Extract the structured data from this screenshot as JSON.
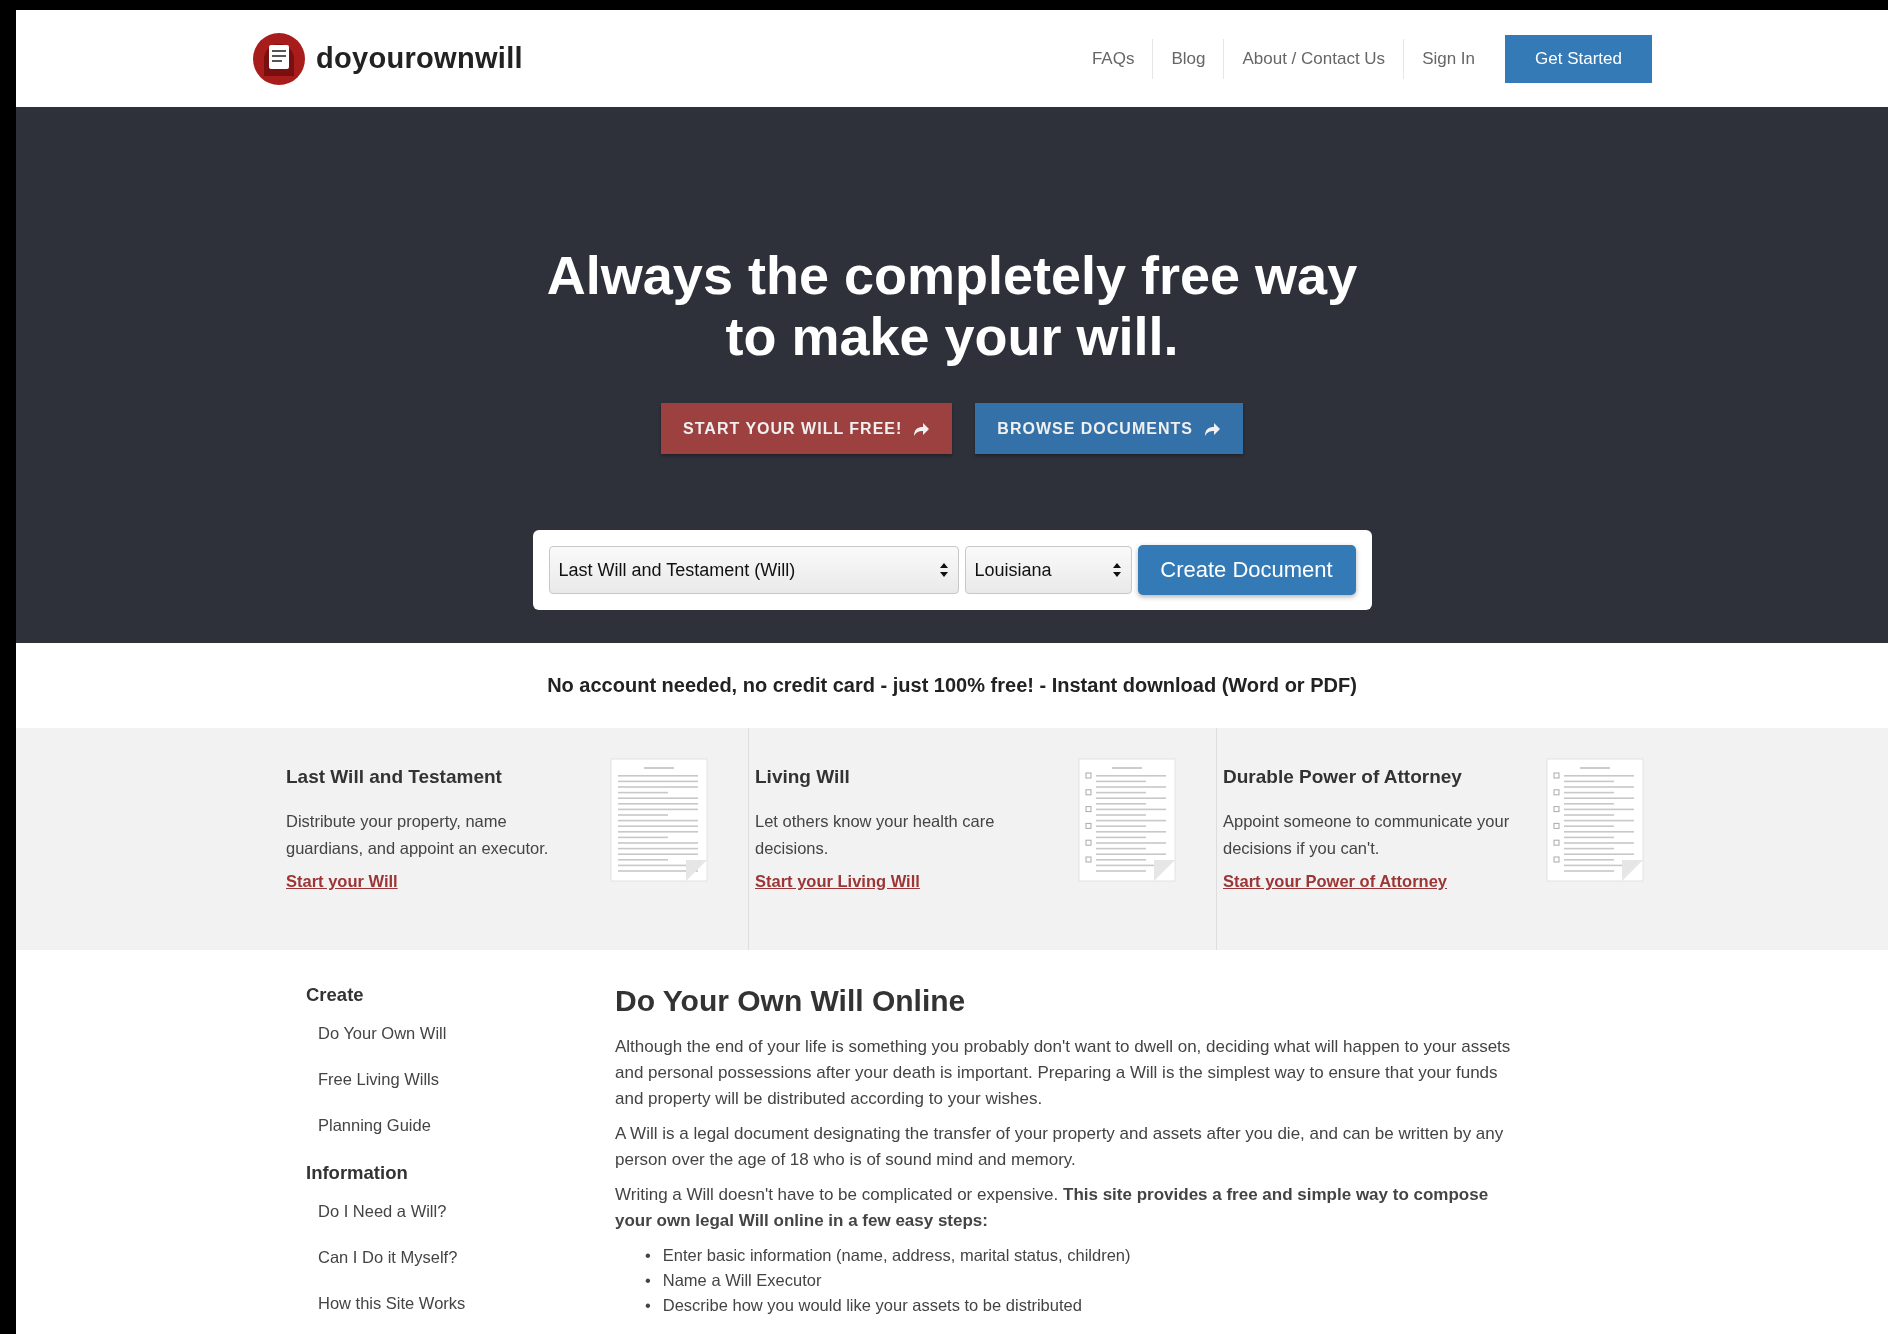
{
  "header": {
    "logo_text": "doyourownwill",
    "nav": [
      {
        "label": "FAQs"
      },
      {
        "label": "Blog"
      },
      {
        "label": "About / Contact Us"
      },
      {
        "label": "Sign In"
      }
    ],
    "cta": "Get Started"
  },
  "hero": {
    "headline": "Always the completely free way to make your will.",
    "buttons": [
      {
        "label": "START YOUR WILL FREE!",
        "kind": "primary"
      },
      {
        "label": "BROWSE DOCUMENTS",
        "kind": "secondary"
      }
    ],
    "form": {
      "document_select": "Last Will and Testament (Will)",
      "state_select": "Louisiana",
      "submit": "Create Document"
    }
  },
  "tagline": "No account needed, no credit card - just 100% free! - Instant download (Word or PDF)",
  "cards": [
    {
      "title": "Last Will and Testament",
      "description": "Distribute your property, name guardians, and appoint an executor.",
      "link": "Start your Will",
      "kind": "text"
    },
    {
      "title": "Living Will",
      "description": "Let others know your health care decisions.",
      "link": "Start your Living Will",
      "kind": "checklist"
    },
    {
      "title": "Durable Power of Attorney",
      "description": "Appoint someone to communicate your decisions if you can't.",
      "link": "Start your Power of Attorney",
      "kind": "checklist"
    }
  ],
  "sidebar": {
    "sections": [
      {
        "heading": "Create",
        "items": [
          "Do Your Own Will",
          "Free Living Wills",
          "Planning Guide"
        ]
      },
      {
        "heading": "Information",
        "items": [
          "Do I Need a Will?",
          "Can I Do it Myself?",
          "How this Site Works"
        ]
      }
    ]
  },
  "article": {
    "title": "Do Your Own Will Online",
    "paragraphs": [
      "Although the end of your life is something you probably don't want to dwell on, deciding what will happen to your assets and personal possessions after your death is important. Preparing a Will is the simplest way to ensure that your funds and property will be distributed according to your wishes.",
      "A Will is a legal document designating the transfer of your property and assets after you die, and can be written by any person over the age of 18 who is of sound mind and memory.",
      "Writing a Will doesn't have to be complicated or expensive. **This site provides a free and simple way to compose your own legal Will online in a few easy steps:**"
    ],
    "bullets": [
      {
        "marker": "•",
        "text": "Enter basic information (name, address, marital status, children)"
      },
      {
        "marker": "•",
        "text": "Name a Will Executor"
      },
      {
        "marker": "•",
        "text": "Describe how you would like your assets to be distributed"
      }
    ]
  }
}
